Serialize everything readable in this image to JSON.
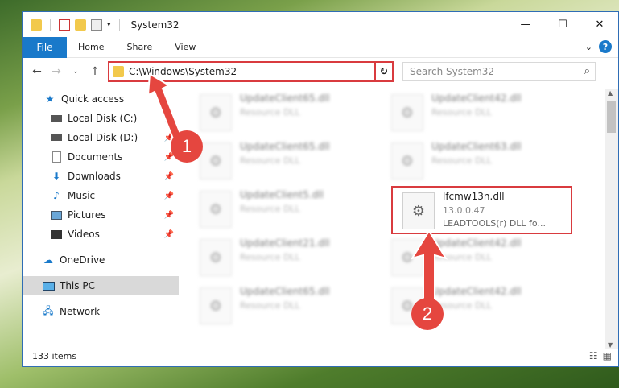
{
  "window": {
    "title": "System32"
  },
  "ribbon": {
    "tabs": [
      "File",
      "Home",
      "Share",
      "View"
    ]
  },
  "window_controls": {
    "minimize": "—",
    "maximize": "☐",
    "close": "✕"
  },
  "address": {
    "path": "C:\\Windows\\System32"
  },
  "search": {
    "placeholder": "Search System32"
  },
  "sidebar": {
    "items": [
      {
        "label": "Quick access",
        "icon": "star-icon"
      },
      {
        "label": "Local Disk (C:)",
        "icon": "drive-icon"
      },
      {
        "label": "Local Disk (D:)",
        "icon": "drive-icon"
      },
      {
        "label": "Documents",
        "icon": "documents-icon"
      },
      {
        "label": "Downloads",
        "icon": "download-icon"
      },
      {
        "label": "Music",
        "icon": "music-icon"
      },
      {
        "label": "Pictures",
        "icon": "pictures-icon"
      },
      {
        "label": "Videos",
        "icon": "videos-icon"
      },
      {
        "label": "OneDrive",
        "icon": "cloud-icon"
      },
      {
        "label": "This PC",
        "icon": "computer-icon"
      },
      {
        "label": "Network",
        "icon": "network-icon"
      }
    ]
  },
  "files": {
    "blurred": [
      {
        "name": "UpdateClient65.dll",
        "desc": "Resource DLL"
      },
      {
        "name": "UpdateClient42.dll",
        "desc": "Resource DLL"
      },
      {
        "name": "UpdateClient65.dll",
        "desc": "Resource DLL"
      },
      {
        "name": "UpdateClient63.dll",
        "desc": "Resource DLL"
      },
      {
        "name": "UpdateClient5.dll",
        "desc": "Resource DLL"
      },
      {
        "name": "UpdateClient21.dll",
        "desc": "Resource DLL"
      },
      {
        "name": "UpdateClient42.dll",
        "desc": "Resource DLL"
      },
      {
        "name": "UpdateClient65.dll",
        "desc": "Resource DLL"
      },
      {
        "name": "UpdateClient42.dll",
        "desc": "Resource DLL"
      }
    ],
    "target": {
      "name": "lfcmw13n.dll",
      "version": "13.0.0.47",
      "desc": "LEADTOOLS(r) DLL fo..."
    }
  },
  "status": {
    "items": "133 items"
  },
  "badges": {
    "one": "1",
    "two": "2"
  },
  "colors": {
    "accent": "#1979ca",
    "highlight": "#d93b3f"
  }
}
